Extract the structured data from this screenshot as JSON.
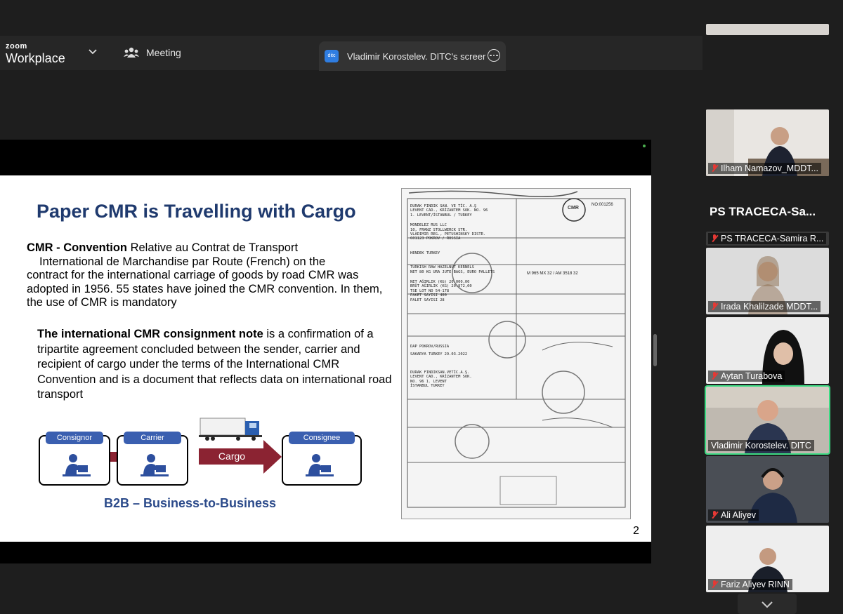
{
  "app": {
    "brand_small": "zoom",
    "brand_big": "Workplace",
    "meeting_label": "Meeting",
    "share_tab_title": "Vladimir Korostelev. DITC's screer",
    "share_tab_icon_text": "ditc"
  },
  "slide": {
    "title": "Paper CMR is Travelling with Cargo",
    "para1_bold": "CMR - Convention",
    "para1_line1": " Relative au Contrat de Transport",
    "para1_line2": "International de Marchandise par Route (French) on the",
    "para1_rest": "contract for the international carriage of goods by road CMR was adopted in 1956. 55 states have joined the CMR convention. In them, the use of CMR is mandatory",
    "para2_bold": "The international CMR consignment note",
    "para2_rest": " is a confirmation of a tripartite agreement concluded between the sender, carrier and recipient of cargo under the terms of the International CMR Convention and is a document that reflects data on international road transport",
    "diagram": {
      "consignor": "Consignor",
      "carrier": "Carrier",
      "consignee": "Consignee",
      "cargo": "Cargo"
    },
    "b2b": "B2B – Business-to-Business",
    "page_number": "2",
    "doc_lines": [
      "DURAK FINDIK SAN. VE TİC. A.Ş",
      "LEVENT CAD., KRİZANTEM SOK. NO. 96",
      "1. LEVENT/İSTANBUL / TURKEY",
      "MONDELEZ RUS LLC",
      "10, FRANZ STOLLWERCK STR.",
      "VLADIMIR REG., PETUSHINSKY DISTR.",
      "601123 POKROV / RUSSIA",
      "HENDEK TURKEY",
      "TURKISH RAW HAZELNUT KERNELS",
      "NET 80 KG URA JUTE BAGS, EURO PALLETS",
      "NET AĞIRLIK (KG)  20.000,00",
      "BRÜT AĞIRLIK (KG)  20.972,00",
      "TSE LOT NO  54-178",
      "PAKET SAYISI  400",
      "PALET SAYISI  28",
      "DAP POKROV/RUSSIA",
      "SAKARYA TURKEY   29.03.2022",
      "DURAK FINDIKSAN.VETİC.A.Ş.",
      "LEVENT CAD., KRİZANTEM SOK.",
      "NO. 96 1. LEVENT",
      "İSTANBUL TURKEY"
    ],
    "doc_stamp": "CMR",
    "doc_number": "NO:001256",
    "doc_plate": "M 965 MX 32 / AM 3518 32"
  },
  "participants": [
    {
      "name": "Ilham Namazov_MDDT...",
      "muted": true
    },
    {
      "name": "PS TRACECA-Samira R...",
      "muted": true
    },
    {
      "name": "Irada Khalilzade MDDT...",
      "muted": true
    },
    {
      "name": "Aytan Turabova",
      "muted": true
    },
    {
      "name": "Vladimir Korostelev. DITC",
      "muted": false,
      "active": true
    },
    {
      "name": "Ali Aliyev",
      "muted": true
    },
    {
      "name": "Fariz Aliyev RINN",
      "muted": true
    }
  ],
  "room_title": "PS  TRACECA-Sa...",
  "colors": {
    "slide_title": "#1f3a6e",
    "accent_blue": "#3a5fb0",
    "cargo_red": "#8b2332",
    "active_speaker": "#3ddc84",
    "mute_red": "#e53935"
  }
}
